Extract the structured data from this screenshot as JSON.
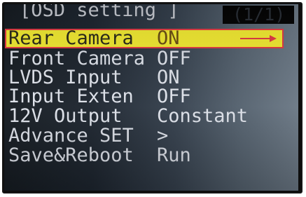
{
  "header": {
    "title": "[OSD setting ]",
    "page": "(1/1)"
  },
  "menu": [
    {
      "label": "Rear Camera",
      "value": "ON"
    },
    {
      "label": "Front Camera",
      "value": "OFF"
    },
    {
      "label": "LVDS Input",
      "value": "ON"
    },
    {
      "label": "Input Exten",
      "value": "OFF"
    },
    {
      "label": "12V Output",
      "value": "Constant"
    },
    {
      "label": "Advance SET",
      "value": ">"
    },
    {
      "label": "Save&Reboot",
      "value": "Run"
    }
  ],
  "colors": {
    "selection_fill": "#f2ea32",
    "selection_border": "#e23a44",
    "arrow": "#e23a44"
  },
  "icons": {
    "selected_row_arrow": "right-arrow-icon"
  }
}
